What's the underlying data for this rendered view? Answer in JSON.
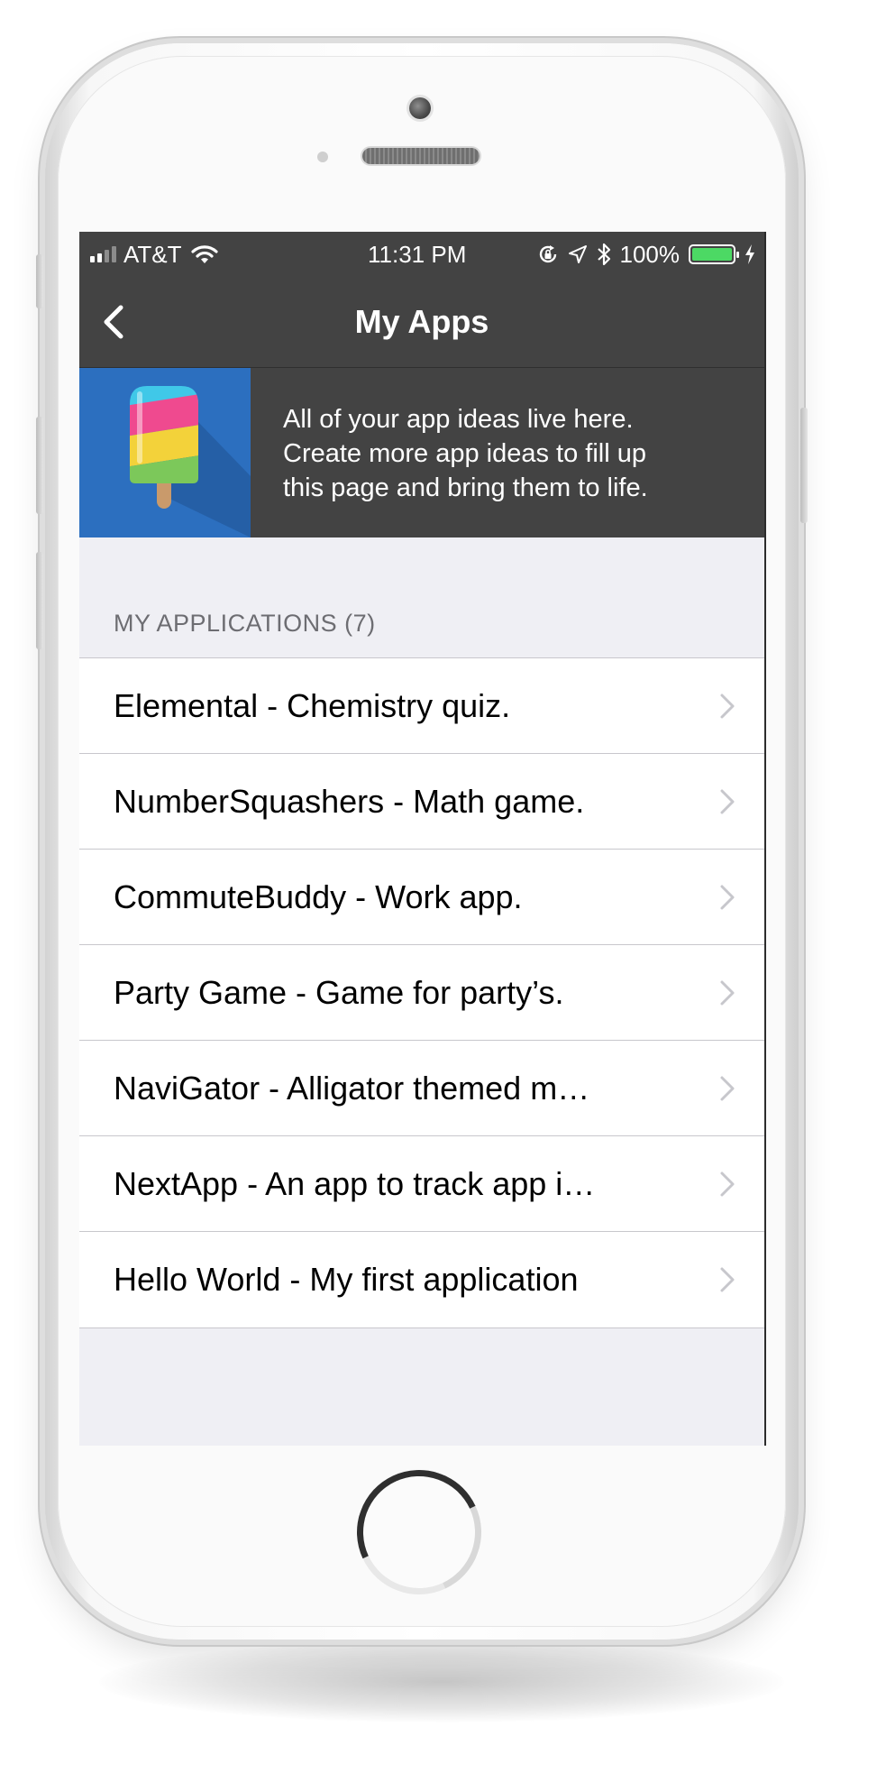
{
  "status_bar": {
    "carrier": "AT&T",
    "time": "11:31 PM",
    "battery_percent": "100%",
    "battery_level": 1.0,
    "icons": [
      "signal-bars-icon",
      "wifi-icon",
      "orientation-lock-icon",
      "location-arrow-icon",
      "bluetooth-icon",
      "battery-icon",
      "charging-bolt-icon"
    ]
  },
  "nav": {
    "title": "My Apps",
    "back_icon": "chevron-left-icon"
  },
  "banner": {
    "image": "popsicle-illustration",
    "text": "All of your app ideas live here.\nCreate more app ideas to fill up\nthis page and bring them to life."
  },
  "section": {
    "header": "MY APPLICATIONS (7)"
  },
  "apps": [
    "Elemental - Chemistry quiz.",
    "NumberSquashers - Math game.",
    "CommuteBuddy - Work app.",
    "Party Game - Game for party’s.",
    "NaviGator - Alligator themed m…",
    "NextApp - An app to track app i…",
    "Hello World - My first application"
  ],
  "colors": {
    "bar_background": "#434343",
    "banner_art_background": "#2c6fbf",
    "list_background": "#efeff4",
    "battery_fill": "#4cd964"
  }
}
